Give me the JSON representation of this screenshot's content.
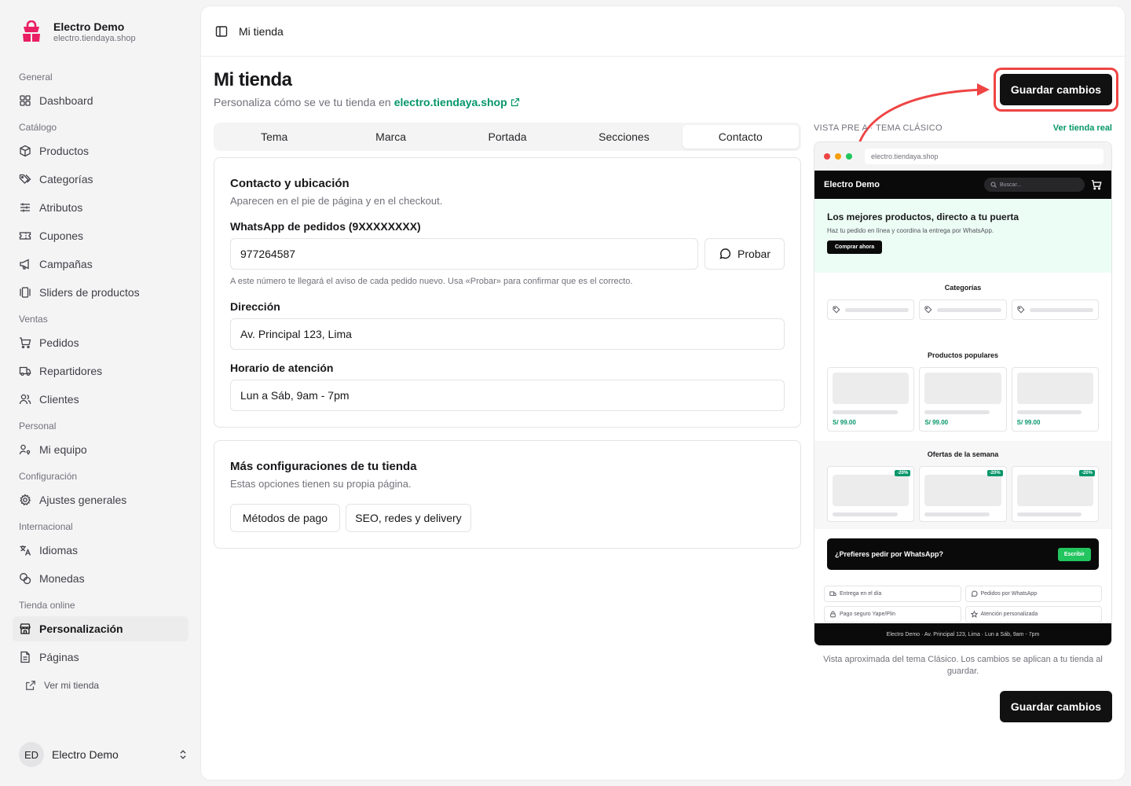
{
  "brand": {
    "name": "Electro Demo",
    "domain": "electro.tiendaya.shop",
    "color": "#e91e63"
  },
  "nav": {
    "groups": [
      {
        "label": "General",
        "items": [
          {
            "label": "Dashboard",
            "icon": "grid-icon"
          }
        ]
      },
      {
        "label": "Catálogo",
        "items": [
          {
            "label": "Productos",
            "icon": "box-icon"
          },
          {
            "label": "Categorías",
            "icon": "tags-icon"
          },
          {
            "label": "Atributos",
            "icon": "sliders-icon"
          },
          {
            "label": "Cupones",
            "icon": "ticket-icon"
          },
          {
            "label": "Campañas",
            "icon": "megaphone-icon"
          },
          {
            "label": "Sliders de productos",
            "icon": "gallery-icon"
          }
        ]
      },
      {
        "label": "Ventas",
        "items": [
          {
            "label": "Pedidos",
            "icon": "cart-icon"
          },
          {
            "label": "Repartidores",
            "icon": "truck-icon"
          },
          {
            "label": "Clientes",
            "icon": "users-icon"
          }
        ]
      },
      {
        "label": "Personal",
        "items": [
          {
            "label": "Mi equipo",
            "icon": "user-key-icon"
          }
        ]
      },
      {
        "label": "Configuración",
        "items": [
          {
            "label": "Ajustes generales",
            "icon": "gear-icon"
          }
        ]
      },
      {
        "label": "Internacional",
        "items": [
          {
            "label": "Idiomas",
            "icon": "languages-icon"
          },
          {
            "label": "Monedas",
            "icon": "coins-icon"
          }
        ]
      },
      {
        "label": "Tienda online",
        "items": [
          {
            "label": "Personalización",
            "icon": "store-icon",
            "active": true
          },
          {
            "label": "Páginas",
            "icon": "file-icon"
          }
        ]
      }
    ],
    "view_store": "Ver mi tienda"
  },
  "user": {
    "initials": "ED",
    "name": "Electro Demo"
  },
  "topbar": {
    "title": "Mi tienda"
  },
  "page": {
    "title": "Mi tienda",
    "subtitle": "Personaliza cómo se ve tu tienda en",
    "subtitle_link": "electro.tiendaya.shop",
    "save_label": "Guardar cambios"
  },
  "tabs": [
    {
      "label": "Tema"
    },
    {
      "label": "Marca"
    },
    {
      "label": "Portada"
    },
    {
      "label": "Secciones"
    },
    {
      "label": "Contacto",
      "active": true
    }
  ],
  "contact": {
    "title": "Contacto y ubicación",
    "desc": "Aparecen en el pie de página y en el checkout.",
    "whatsapp_label": "WhatsApp de pedidos (9XXXXXXXX)",
    "whatsapp_value": "977264587",
    "test_label": "Probar",
    "whatsapp_hint": "A este número te llegará el aviso de cada pedido nuevo. Usa «Probar» para confirmar que es el correcto.",
    "address_label": "Dirección",
    "address_value": "Av. Principal 123, Lima",
    "hours_label": "Horario de atención",
    "hours_value": "Lun a Sáb, 9am - 7pm"
  },
  "more": {
    "title": "Más configuraciones de tu tienda",
    "desc": "Estas opciones tienen su propia página.",
    "payments_label": "Métodos de pago",
    "seo_label": "SEO, redes y delivery"
  },
  "preview": {
    "label": "VISTA PRE  A · TEMA CLÁSICO",
    "live_link": "Ver tienda real",
    "url": "electro.tiendaya.shop",
    "store_name": "Electro Demo",
    "search_placeholder": "Buscar...",
    "hero_title": "Los mejores productos, directo a tu puerta",
    "hero_sub": "Haz tu pedido en línea y coordina la entrega por WhatsApp.",
    "hero_btn": "Comprar ahora",
    "categories_title": "Categorías",
    "popular_title": "Productos populares",
    "price": "S/ 99.00",
    "offers_title": "Ofertas de la semana",
    "discount": "-20%",
    "wa_text": "¿Prefieres pedir por WhatsApp?",
    "wa_btn": "Escribir",
    "features": [
      "Entrega en el día",
      "Pedidos por WhatsApp",
      "Pago seguro Yape/Plin",
      "Atención personalizada"
    ],
    "footer": "Electro Demo · Av. Principal 123, Lima · Lun a Sáb, 9am - 7pm",
    "caption": "Vista aproximada del tema Clásico. Los cambios se aplican a tu tienda al guardar."
  },
  "colors": {
    "accent": "#059669",
    "highlight": "#ef4444",
    "dark": "#111111"
  }
}
